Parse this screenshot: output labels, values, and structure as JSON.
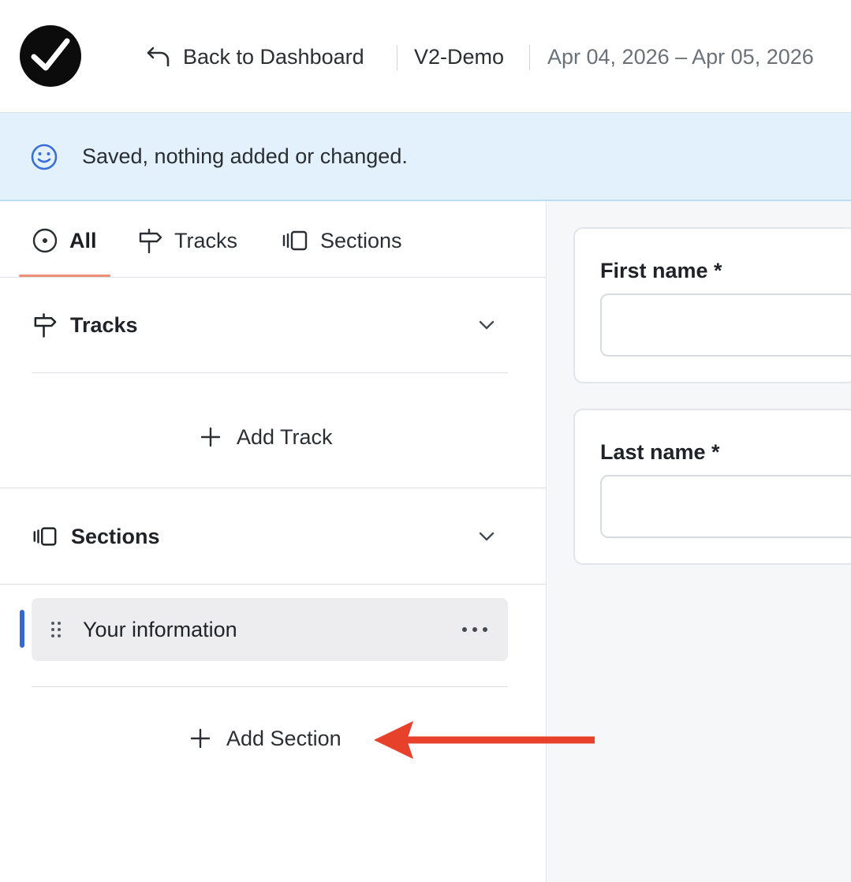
{
  "header": {
    "logo_icon": "checkmark-logo-icon",
    "back_icon": "back-arrow-icon",
    "back_label": "Back to Dashboard",
    "project_name": "V2-Demo",
    "date_range": "Apr 04, 2026 – Apr 05, 2026"
  },
  "banner": {
    "icon": "smiley-icon",
    "message": "Saved, nothing added or changed.",
    "background": "#e2f1fb",
    "icon_color": "#3b6fd6"
  },
  "sidebar": {
    "tabs": [
      {
        "label": "All",
        "icon": "target-icon",
        "active": true
      },
      {
        "label": "Tracks",
        "icon": "signpost-icon",
        "active": false
      },
      {
        "label": "Sections",
        "icon": "sections-icon",
        "active": false
      }
    ],
    "tracks_group": {
      "label": "Tracks",
      "icon": "signpost-icon",
      "add_label": "Add Track"
    },
    "sections_group": {
      "label": "Sections",
      "icon": "sections-icon",
      "items": [
        {
          "label": "Your information",
          "selected": true
        }
      ],
      "add_label": "Add Section"
    },
    "accent_color": "#ef8e77",
    "selected_color": "#3567d6"
  },
  "form": {
    "fields": [
      {
        "label": "First name *",
        "value": ""
      },
      {
        "label": "Last name *",
        "value": ""
      }
    ]
  },
  "annotation": {
    "arrow_color": "#e8412b"
  }
}
